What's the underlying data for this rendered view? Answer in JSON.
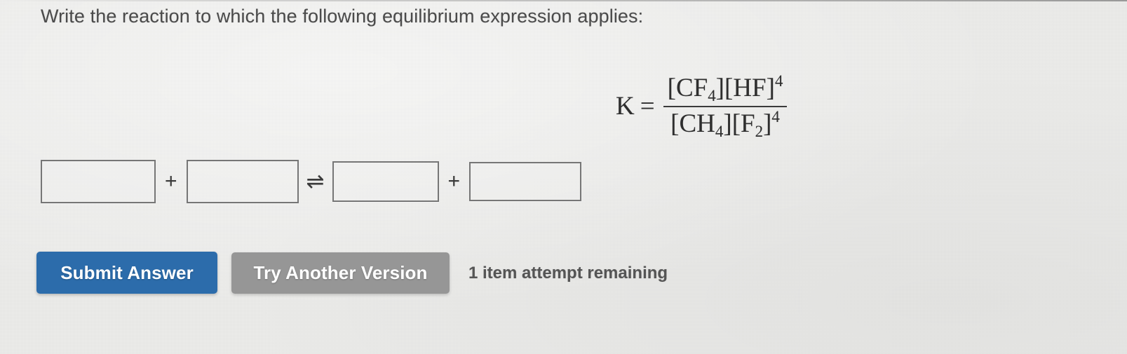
{
  "prompt": "Write the reaction to which the following equilibrium expression applies:",
  "equilibrium": {
    "k_label": "K",
    "equals": "=",
    "numerator_terms": [
      {
        "species": "CF",
        "subscript": "4",
        "exponent": ""
      },
      {
        "species": "HF",
        "subscript": "",
        "exponent": "4"
      }
    ],
    "denominator_terms": [
      {
        "species": "CH",
        "subscript": "4",
        "exponent": ""
      },
      {
        "species": "F",
        "subscript": "2",
        "exponent": "4"
      }
    ],
    "numerator_text": "[CF4][HF]4",
    "denominator_text": "[CH4][F2]4",
    "plain": "K = [CF4][HF]^4 / [CH4][F2]^4"
  },
  "reaction": {
    "boxes": [
      {
        "value": "",
        "placeholder": ""
      },
      {
        "value": "",
        "placeholder": ""
      },
      {
        "value": "",
        "placeholder": ""
      },
      {
        "value": "",
        "placeholder": ""
      }
    ],
    "operators": {
      "plus": "+",
      "equilibrium_arrow": "⇌"
    }
  },
  "actions": {
    "submit_label": "Submit Answer",
    "try_another_label": "Try Another Version",
    "attempts_text": "1 item attempt remaining"
  },
  "colors": {
    "submit_blue": "#2c6cab",
    "try_another_gray": "#969696",
    "page_background": "#ececea",
    "box_border": "#767676",
    "text": "#4b4b4b"
  }
}
